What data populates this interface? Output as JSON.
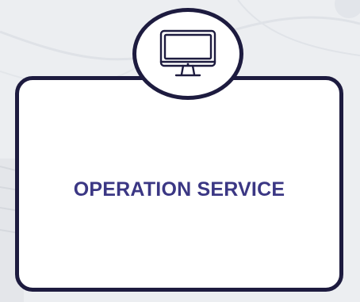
{
  "card": {
    "title": "OPERATION SERVICE"
  },
  "icon": {
    "name": "desktop-monitor-icon"
  },
  "colors": {
    "border": "#1d1b3f",
    "title": "#3b3784",
    "background": "#eceef1",
    "card": "#ffffff"
  }
}
